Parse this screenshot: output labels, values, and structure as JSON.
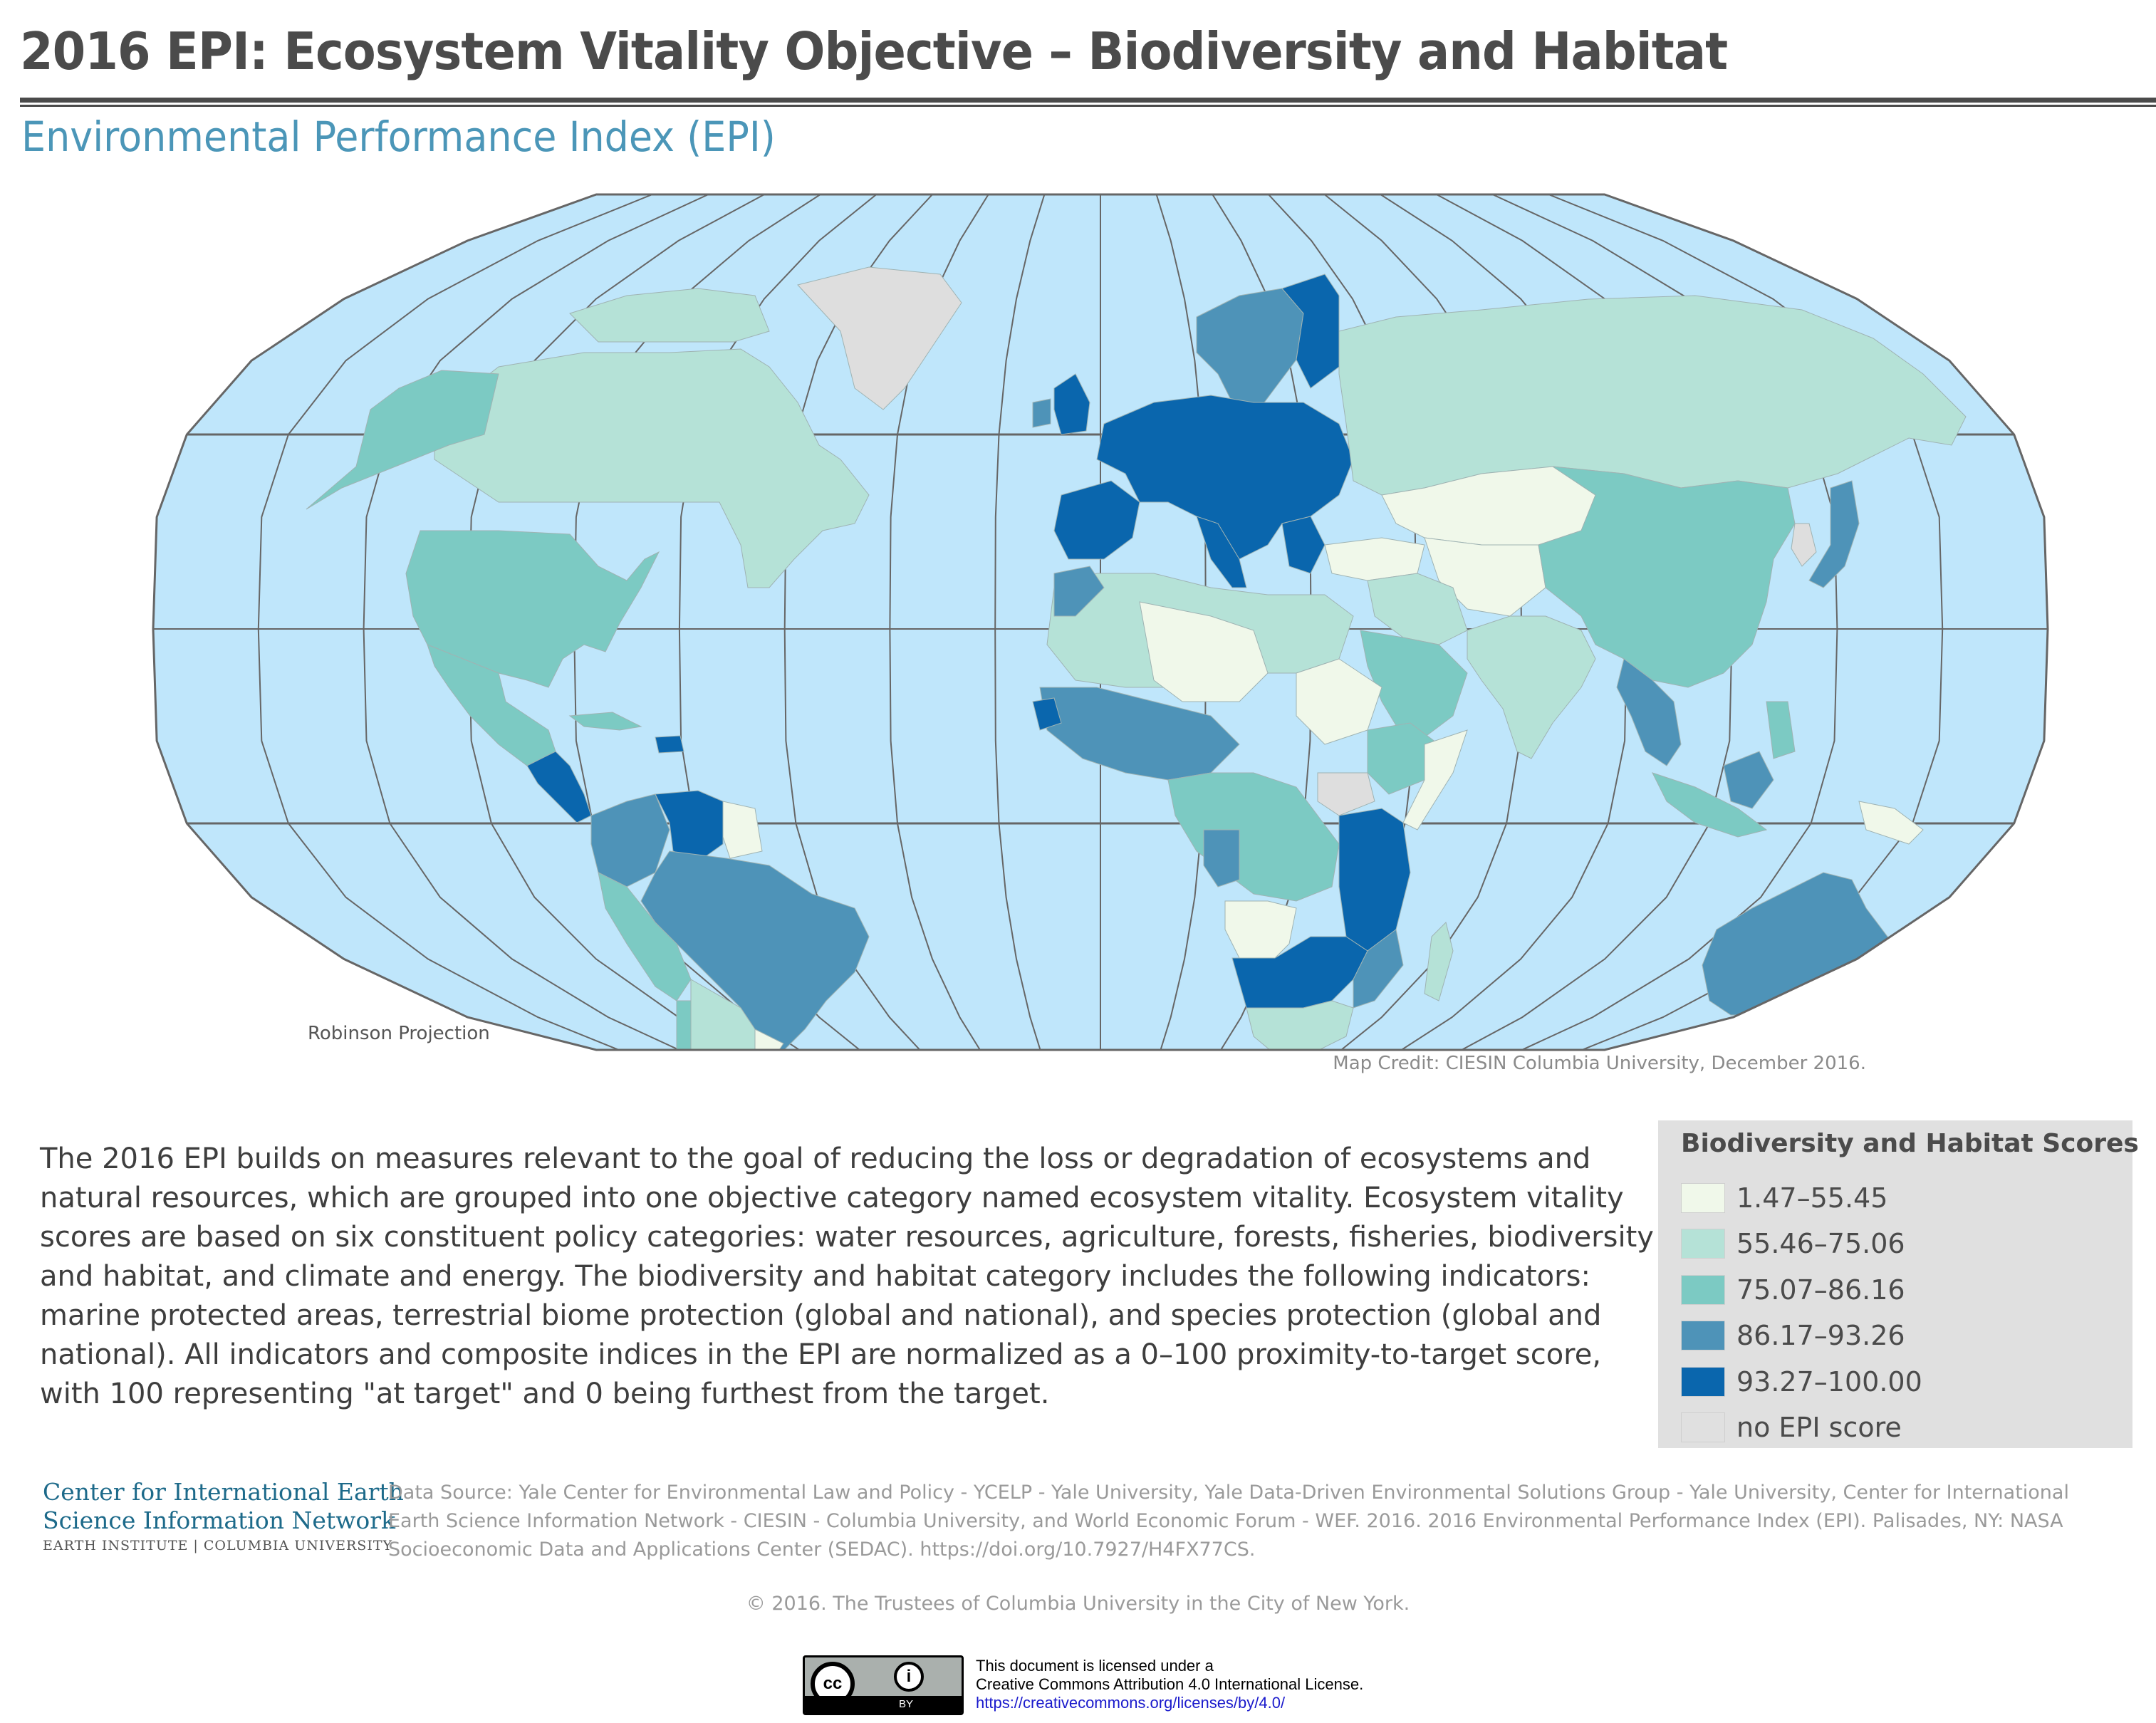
{
  "header": {
    "title": "2016 EPI: Ecosystem Vitality Objective – Biodiversity and Habitat",
    "subtitle": "Environmental Performance Index (EPI)"
  },
  "map": {
    "projection_label": "Robinson Projection",
    "credit": "Map Credit: CIESIN Columbia University, December 2016.",
    "colors": {
      "ocean": "#bfe6fb",
      "graticule": "#666666",
      "class1": "#f0f8ea",
      "class2": "#b5e2d7",
      "class3": "#7ccac3",
      "class4": "#4e93b8",
      "class5": "#0a66ad",
      "nodata": "#dedede"
    },
    "regions": [
      {
        "name": "Canada",
        "class": "class2"
      },
      {
        "name": "United States",
        "class": "class3"
      },
      {
        "name": "Alaska",
        "class": "class3"
      },
      {
        "name": "Mexico",
        "class": "class3"
      },
      {
        "name": "Greenland",
        "class": "nodata"
      },
      {
        "name": "Central America",
        "class": "class5"
      },
      {
        "name": "Venezuela",
        "class": "class5"
      },
      {
        "name": "Brazil",
        "class": "class4"
      },
      {
        "name": "Colombia",
        "class": "class4"
      },
      {
        "name": "Peru",
        "class": "class3"
      },
      {
        "name": "Argentina",
        "class": "class2"
      },
      {
        "name": "Chile",
        "class": "class3"
      },
      {
        "name": "Uruguay",
        "class": "class1"
      },
      {
        "name": "Western Europe",
        "class": "class5"
      },
      {
        "name": "Scandinavia",
        "class": "class4"
      },
      {
        "name": "Russia",
        "class": "class2"
      },
      {
        "name": "Kazakhstan",
        "class": "class1"
      },
      {
        "name": "China",
        "class": "class3"
      },
      {
        "name": "India",
        "class": "class2"
      },
      {
        "name": "Japan",
        "class": "class4"
      },
      {
        "name": "North Africa",
        "class": "class2"
      },
      {
        "name": "Sahara",
        "class": "class1"
      },
      {
        "name": "West Africa",
        "class": "class4"
      },
      {
        "name": "Central Africa",
        "class": "class3"
      },
      {
        "name": "East Africa",
        "class": "class5"
      },
      {
        "name": "Southern Africa",
        "class": "class5"
      },
      {
        "name": "Angola",
        "class": "class1"
      },
      {
        "name": "South Africa",
        "class": "class2"
      },
      {
        "name": "Madagascar",
        "class": "class2"
      },
      {
        "name": "Arabia",
        "class": "class3"
      },
      {
        "name": "Southeast Asia",
        "class": "class4"
      },
      {
        "name": "Indonesia",
        "class": "class3"
      },
      {
        "name": "Papua New Guinea",
        "class": "class1"
      },
      {
        "name": "Australia",
        "class": "class4"
      },
      {
        "name": "New Zealand",
        "class": "class4"
      }
    ]
  },
  "description": "The 2016 EPI builds on measures relevant to the goal of reducing the loss or degradation of ecosystems and natural resources, which are grouped into one objective category named ecosystem vitality. Ecosystem vitality scores are based on six constituent policy categories: water resources, agriculture, forests, fisheries, biodiversity and habitat, and climate and energy. The biodiversity and habitat category includes the following indicators: marine protected areas, terrestrial biome protection (global and national), and species protection (global and national). All indicators and composite indices in the EPI are normalized as a 0–100 proximity-to-target score, with 100 representing \"at target\" and 0 being furthest from the target.",
  "legend": {
    "title": "Biodiversity and Habitat Scores",
    "items": [
      {
        "label": "1.47–55.45",
        "color": "#f0f8ea"
      },
      {
        "label": "55.46–75.06",
        "color": "#b5e2d7"
      },
      {
        "label": "75.07–86.16",
        "color": "#7ccac3"
      },
      {
        "label": "86.17–93.26",
        "color": "#4e93b8"
      },
      {
        "label": "93.27–100.00",
        "color": "#0a66ad"
      },
      {
        "label": "no EPI score",
        "color": "#e0e0e0"
      }
    ]
  },
  "footer": {
    "org_line1": "Center for International Earth",
    "org_line2": "Science Information Network",
    "org_line3": "EARTH INSTITUTE | COLUMBIA UNIVERSITY",
    "data_source": "Data Source: Yale Center for Environmental Law and Policy - YCELP - Yale University, Yale Data-Driven Environmental Solutions Group - Yale University, Center for International Earth Science Information Network - CIESIN - Columbia University, and World Economic Forum - WEF. 2016. 2016 Environmental Performance Index (EPI). Palisades, NY: NASA Socioeconomic Data and Applications Center (SEDAC). https://doi.org/10.7927/H4FX77CS.",
    "copyright": "© 2016. The Trustees of Columbia University in the City of New York.",
    "cc_text": "cc",
    "by_icon_text": "i",
    "by_text": "BY",
    "license_line1": "This document is licensed under a",
    "license_line2": "Creative Commons Attribution 4.0 International License.",
    "license_url": "https://creativecommons.org/licenses/by/4.0/"
  }
}
